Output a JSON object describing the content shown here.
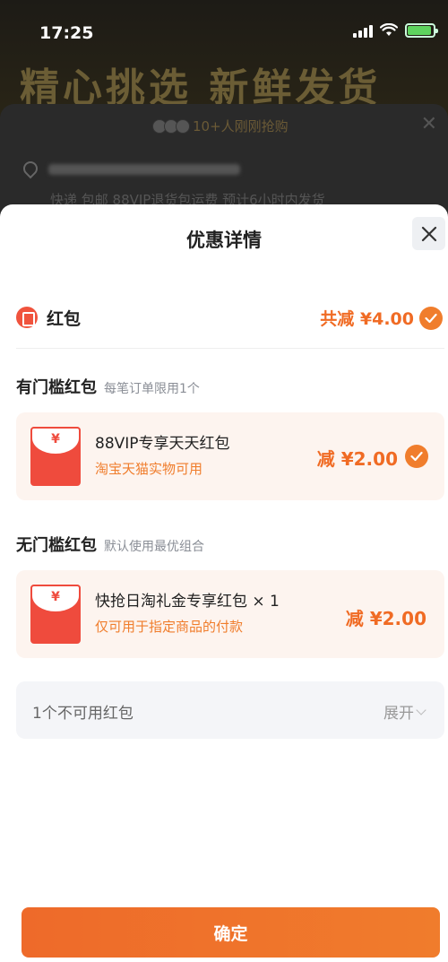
{
  "status_bar": {
    "time": "17:25"
  },
  "background_page": {
    "headline": "精心挑选 新鲜发货",
    "buyers_text": "10+人刚刚抢购",
    "delivery_text": "快递 包邮 88VIP退货包运费 预计6小时内发货"
  },
  "sheet": {
    "title": "优惠详情",
    "close_icon": "close-icon"
  },
  "summary": {
    "label": "红包",
    "total": "共减 ¥4.00"
  },
  "threshold_section": {
    "title": "有门槛红包",
    "note": "每笔订单限用1个",
    "coupon": {
      "icon_symbol": "¥",
      "title": "88VIP专享天天红包",
      "subtitle": "淘宝天猫实物可用",
      "amount": "减 ¥2.00",
      "selected": true
    }
  },
  "no_threshold_section": {
    "title": "无门槛红包",
    "note": "默认使用最优组合",
    "coupon": {
      "icon_symbol": "¥",
      "title": "快抢日淘礼金专享红包 × 1",
      "subtitle": "仅可用于指定商品的付款",
      "amount": "减 ¥2.00"
    }
  },
  "unavailable": {
    "label": "1个不可用红包",
    "expand_label": "展开"
  },
  "confirm_button": {
    "label": "确定"
  },
  "colors": {
    "accent": "#f06b24",
    "red_packet": "#ef4b3d",
    "coupon_bg": "#fdf4ef"
  }
}
